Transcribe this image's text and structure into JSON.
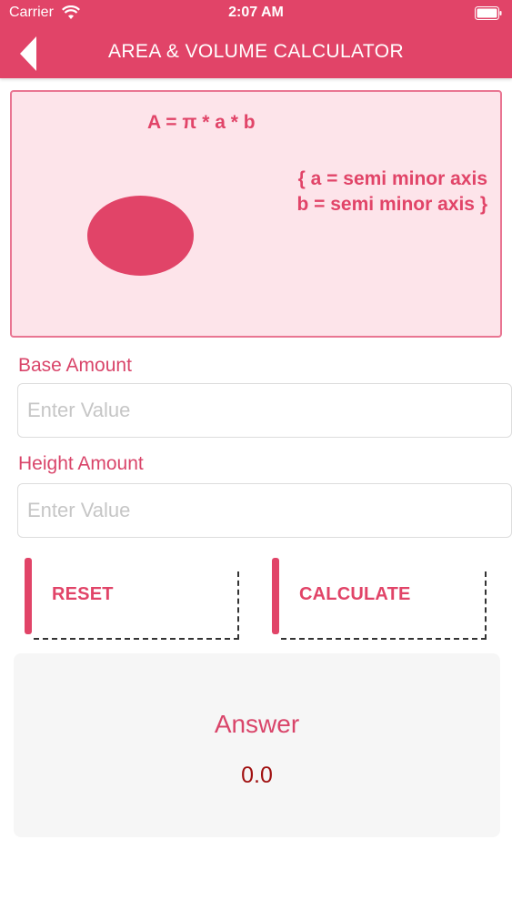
{
  "status_bar": {
    "carrier": "Carrier",
    "time": "2:07 AM"
  },
  "app_bar": {
    "title": "AREA & VOLUME CALCULATOR",
    "back_icon": "chevron-left-icon"
  },
  "formula_card": {
    "formula": "A = π * a * b",
    "legend_line1": "{ a = semi minor axis",
    "legend_line2": "b = semi minor axis }",
    "shape": "ellipse"
  },
  "fields": [
    {
      "label": "Base Amount",
      "placeholder": "Enter Value",
      "value": ""
    },
    {
      "label": "Height Amount",
      "placeholder": "Enter Value",
      "value": ""
    }
  ],
  "buttons": {
    "reset_label": "RESET",
    "calculate_label": "CALCULATE"
  },
  "answer": {
    "title": "Answer",
    "value": "0.0"
  },
  "colors": {
    "accent": "#e14468",
    "card_background": "#fde4ea",
    "answer_value": "#a01010"
  }
}
